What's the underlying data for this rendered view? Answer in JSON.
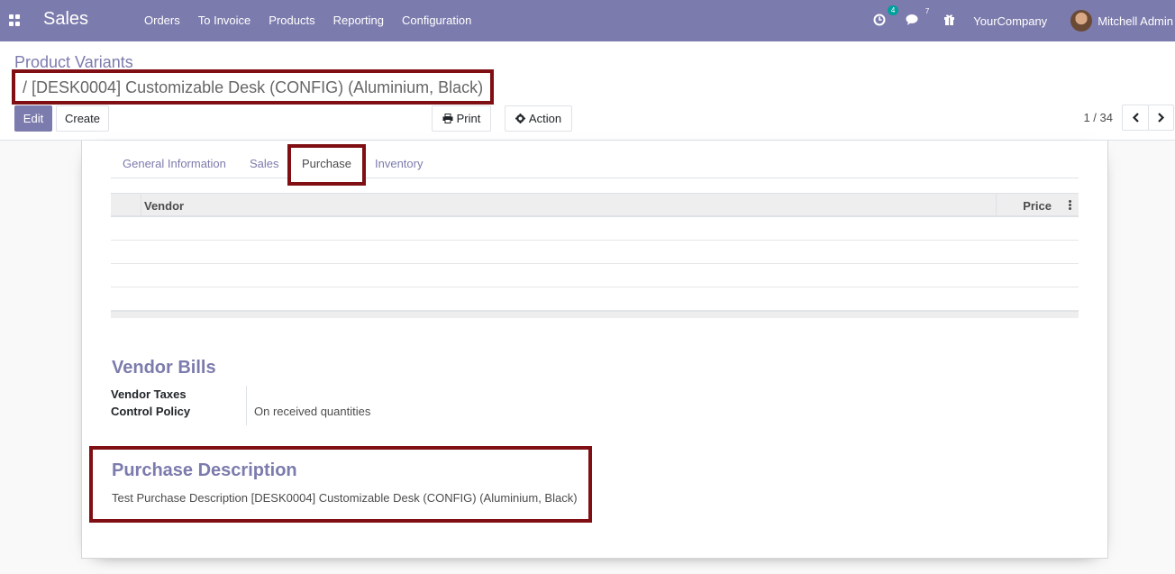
{
  "navbar": {
    "app_name": "Sales",
    "menu": [
      "Orders",
      "To Invoice",
      "Products",
      "Reporting",
      "Configuration"
    ],
    "activity_count": "4",
    "messages_count": "7",
    "company": "YourCompany",
    "user": "Mitchell Admin"
  },
  "breadcrumb": {
    "parent": "Product Variants",
    "current": "/ [DESK0004] Customizable Desk (CONFIG) (Aluminium, Black)"
  },
  "buttons": {
    "edit": "Edit",
    "create": "Create",
    "print": "Print",
    "action": "Action"
  },
  "pager": {
    "value": "1 / 34"
  },
  "tabs": [
    "General Information",
    "Sales",
    "Purchase",
    "Inventory"
  ],
  "active_tab": "Purchase",
  "vendor_table": {
    "columns": [
      "Vendor",
      "Price"
    ]
  },
  "vendor_bills": {
    "title": "Vendor Bills",
    "taxes_label": "Vendor Taxes",
    "control_policy_label": "Control Policy",
    "control_policy_value": "On received quantities"
  },
  "purchase_description": {
    "title": "Purchase Description",
    "text": "Test Purchase Description [DESK0004] Customizable Desk (CONFIG) (Aluminium, Black)"
  },
  "colors": {
    "brand": "#7c7bad",
    "highlight": "#7f0f13",
    "badge": "#00a09d"
  }
}
